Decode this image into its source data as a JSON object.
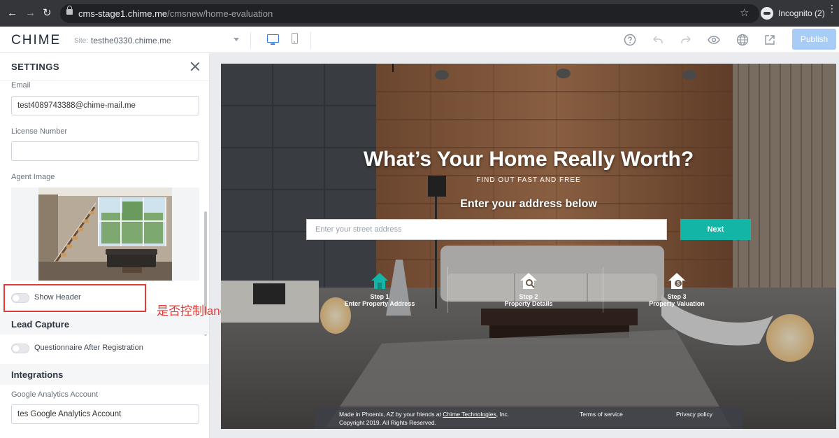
{
  "browser": {
    "url_host": "cms-stage1.chime.me",
    "url_path": "/cmsnew/home-evaluation",
    "profile_label": "Incognito (2)"
  },
  "toolbar": {
    "logo": "CHIME",
    "site_label": "Site:",
    "site_value": "testhe0330.chime.me",
    "publish_label": "Publish",
    "icons": [
      "help-icon",
      "undo-icon",
      "redo-icon",
      "preview-eye-icon",
      "globe-icon",
      "share-icon"
    ],
    "publish_color": "#a7ccf6"
  },
  "settings": {
    "title": "SETTINGS",
    "email_label": "Email",
    "email_value": "test4089743388@chime-mail.me",
    "license_label": "License Number",
    "license_value": "",
    "agent_image_label": "Agent Image",
    "show_header_label": "Show Header",
    "lead_capture_title": "Lead Capture",
    "questionnaire_label": "Questionnaire After Registration",
    "integrations_title": "Integrations",
    "ga_label": "Google Analytics Account",
    "ga_value": "tes Google Analytics Account",
    "annotation": "是否控制landing page",
    "annotation_color": "#e53935"
  },
  "preview": {
    "title": "What’s Your Home Really Worth?",
    "subtitle": "FIND OUT FAST AND FREE",
    "cta": "Enter your address below",
    "address_placeholder": "Enter your street address",
    "next_label": "Next",
    "accent_color": "#12b5a6",
    "steps": [
      {
        "num": "Step 1",
        "text": "Enter Property Address",
        "icon": "house-icon"
      },
      {
        "num": "Step 2",
        "text": "Property Details",
        "icon": "house-search-icon"
      },
      {
        "num": "Step 3",
        "text": "Property Valuation",
        "icon": "house-dollar-icon"
      }
    ],
    "footer": {
      "made_prefix": "Made in Phoenix, AZ by your friends at ",
      "made_link": "Chime Technologies",
      "made_suffix": ", Inc.",
      "copyright": "Copyright 2019. All Rights Reserved.",
      "terms": "Terms of service",
      "privacy": "Privacy policy"
    }
  }
}
